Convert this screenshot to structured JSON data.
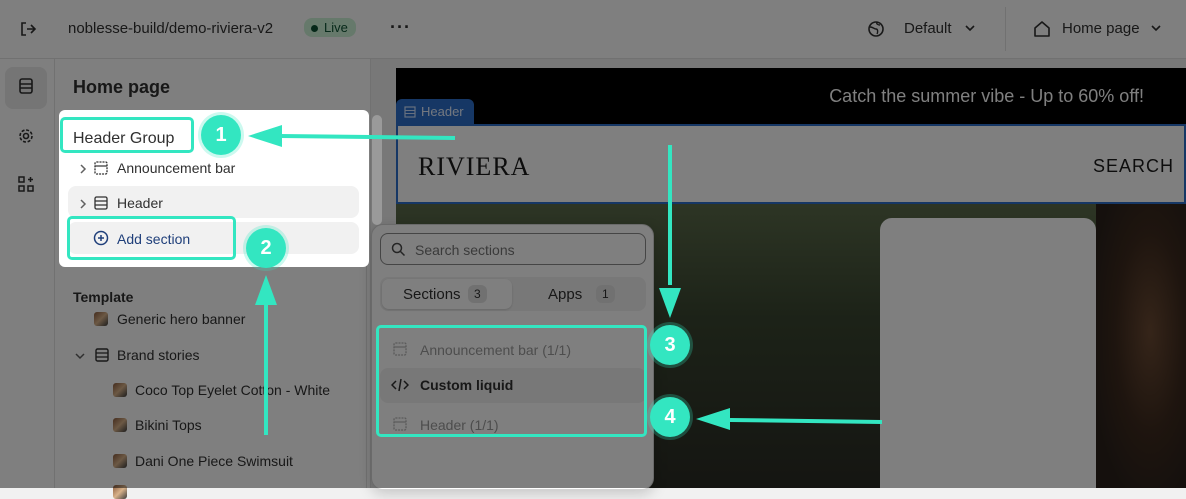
{
  "topbar": {
    "store_name": "noblesse-build/demo-riviera-v2",
    "status_badge": "Live",
    "more_icon": "more-horizontal-icon",
    "theme_select": "Default",
    "page_select": "Home page"
  },
  "sidebar": {
    "title": "Home page",
    "header_group": {
      "title": "Header Group",
      "items": [
        {
          "label": "Announcement bar",
          "icon": "section-icon"
        },
        {
          "label": "Header",
          "icon": "section-icon"
        }
      ],
      "add_section_label": "Add section"
    },
    "template": {
      "title": "Template",
      "items": [
        {
          "label": "Generic hero banner",
          "icon": "image-thumb"
        },
        {
          "label": "Brand stories",
          "icon": "section-icon"
        }
      ],
      "sub_items": [
        {
          "label": "Coco Top Eyelet Cotton - White"
        },
        {
          "label": "Bikini Tops"
        },
        {
          "label": "Dani One Piece Swimsuit"
        }
      ]
    }
  },
  "preview": {
    "announcement_text": "Catch the summer vibe - Up to 60% off!",
    "header_tag": "Header",
    "logo": "RIVIERA",
    "search_label": "SEARCH"
  },
  "popover": {
    "search_placeholder": "Search sections",
    "tabs": [
      {
        "label": "Sections",
        "count": "3"
      },
      {
        "label": "Apps",
        "count": "1"
      }
    ],
    "items": [
      {
        "label": "Announcement bar (1/1)",
        "disabled": true
      },
      {
        "label": "Custom liquid",
        "disabled": false
      },
      {
        "label": "Header (1/1)",
        "disabled": true
      }
    ]
  },
  "annotations": {
    "steps": [
      "1",
      "2",
      "3",
      "4"
    ],
    "color": "#33e6c1"
  }
}
